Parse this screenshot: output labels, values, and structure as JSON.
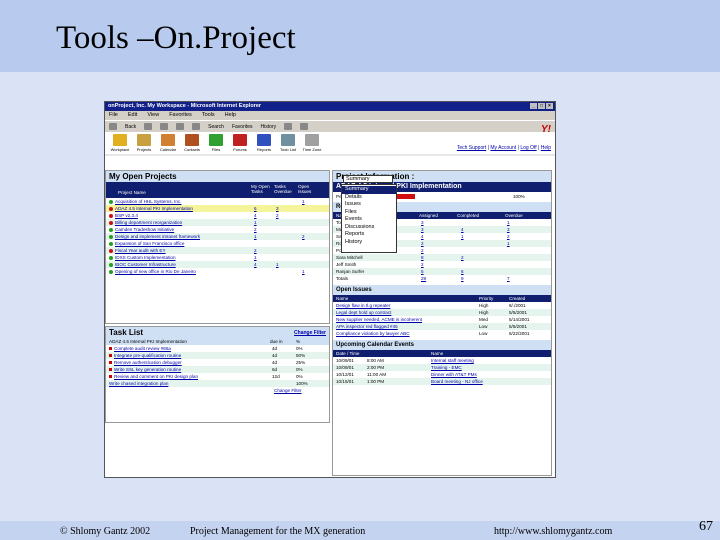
{
  "slide": {
    "title": "Tools –On.Project",
    "footer_left": "© Shlomy Gantz 2002",
    "footer_center": "Project Management for the MX generation",
    "footer_right": "http://www.shlomygantz.com",
    "page_number": "67"
  },
  "browser": {
    "window_title": "onProject, Inc. My Workspace - Microsoft Internet Explorer",
    "menu": [
      "File",
      "Edit",
      "View",
      "Favorites",
      "Tools",
      "Help"
    ],
    "nav": [
      "Back",
      "Search",
      "Favorites",
      "History"
    ],
    "tools": [
      "Workplace",
      "Projects",
      "Calendar",
      "Contacts",
      "Files",
      "Forums",
      "Reports",
      "Todo List",
      "Time Zone"
    ],
    "top_links": [
      "Tech Support",
      "My Account",
      "Log Off",
      "Help"
    ]
  },
  "open_projects": {
    "title": "My Open Projects",
    "headers": [
      "Project Name",
      "My Open Tasks",
      "Tasks Overdue",
      "Open Issues"
    ],
    "rows": [
      {
        "name": "Acquisition of HHL Systems, Inc.",
        "tasks": "",
        "overdue": "",
        "issues": "1",
        "color": "#22a022"
      },
      {
        "name": "ADAZ 4.5 Internal PKI Implementation",
        "tasks": "6",
        "overdue": "3",
        "issues": "",
        "color": "#d01010"
      },
      {
        "name": "BSP v2.3.4",
        "tasks": "4",
        "overdue": "2",
        "issues": "",
        "color": "#d01010"
      },
      {
        "name": "Billing department reorganization",
        "tasks": "1",
        "overdue": "",
        "issues": "",
        "color": "#d01010"
      },
      {
        "name": "Camden Tradeshow Initiative",
        "tasks": "2",
        "overdue": "",
        "issues": "",
        "color": "#22a022"
      },
      {
        "name": "Design and implement intranet framework",
        "tasks": "1",
        "overdue": "",
        "issues": "2",
        "color": "#22a022"
      },
      {
        "name": "Expansion of San Francisco office",
        "tasks": "",
        "overdue": "",
        "issues": "",
        "color": "#22a022"
      },
      {
        "name": "Fiscal Year audit with EY",
        "tasks": "2",
        "overdue": "",
        "issues": "",
        "color": "#d01010"
      },
      {
        "name": "IDXS Custom Implementation",
        "tasks": "1",
        "overdue": "",
        "issues": "",
        "color": "#22a022"
      },
      {
        "name": "IBOC Customer Infrastructure",
        "tasks": "4",
        "overdue": "1",
        "issues": "",
        "color": "#22a022"
      },
      {
        "name": "Opening of new office in Rio De Janeiro",
        "tasks": "",
        "overdue": "",
        "issues": "1",
        "color": "#22a022"
      }
    ]
  },
  "task_list": {
    "title": "Task List",
    "change_filter": "Change Filter",
    "headers": [
      "ADAZ 4.5 Internal PKI Implementation",
      "due in",
      "%"
    ],
    "rows": [
      {
        "name": "Complete audit review #66a",
        "due": "4d",
        "pct": "0%"
      },
      {
        "name": "Integrate pre-qualification routine",
        "due": "4d",
        "pct": "50%"
      },
      {
        "name": "Remove authentication debugger",
        "due": "4d",
        "pct": "25%"
      },
      {
        "name": "Write SSL key generation routine",
        "due": "6d",
        "pct": "0%"
      },
      {
        "name": "Review and comment on PKI design plan",
        "due": "12d",
        "pct": "0%"
      },
      {
        "name": "Write chased integration plan",
        "due": "",
        "pct": "100%"
      }
    ]
  },
  "project_info": {
    "title": "Project Information :",
    "select_value": "Summary",
    "dropdown": [
      "Summary",
      "Details",
      "Issues",
      "Files",
      "Events",
      "Discussions",
      "Reports",
      "History"
    ],
    "banner": "ADAZ 4.5 Internal PKI Implementation",
    "percent_label": "Percent Complete",
    "percent_value": "100%",
    "resources_title": "Resources",
    "resources_headers": [
      "Name",
      "Assigned",
      "Completed",
      "Overdue"
    ],
    "resources": [
      {
        "name": "Tony Andrews",
        "a": "3",
        "c": "",
        "o": "1"
      },
      {
        "name": "Maria Brooks",
        "a": "3",
        "c": "4",
        "o": "3"
      },
      {
        "name": "Samantha Condor",
        "a": "4",
        "c": "1",
        "o": "2"
      },
      {
        "name": "Roy Boner",
        "a": "2",
        "c": "",
        "o": "1"
      },
      {
        "name": "Pol Jessop",
        "a": "2",
        "c": "",
        "o": ""
      },
      {
        "name": "Sara Mitchell",
        "a": "8",
        "c": "2",
        "o": ""
      },
      {
        "name": "Jeff Smith",
        "a": "2",
        "c": "",
        "o": ""
      },
      {
        "name": "Ranjan Surfer",
        "a": "5",
        "c": "6",
        "o": ""
      },
      {
        "name": "Totals",
        "a": "29",
        "c": "9",
        "o": "7"
      }
    ]
  },
  "open_issues": {
    "title": "Open Issues",
    "headers": [
      "Name",
      "Priority",
      "Created"
    ],
    "rows": [
      {
        "name": "Design flaw in tl.g repeater",
        "p": "High",
        "d": "6/./2001"
      },
      {
        "name": "Legal dept hold up contract",
        "p": "High",
        "d": "5/5/2001"
      },
      {
        "name": "New supplier needed, ACME is incoherent",
        "p": "Med",
        "d": "5/14/2001"
      },
      {
        "name": "APA inspector red flagged #45",
        "p": "Low",
        "d": "5/5/2001"
      },
      {
        "name": "Compliance violation by lawyer ABC",
        "p": "Low",
        "d": "6/22/2001"
      }
    ]
  },
  "calendar": {
    "title": "Upcoming Calendar Events",
    "headers": [
      "Date / Time",
      "Name"
    ],
    "rows": [
      {
        "date": "10/09/01",
        "time": "8:00 AM",
        "name": "Internal staff meeting"
      },
      {
        "date": "10/09/01",
        "time": "2:00 PM",
        "name": "Training - EMC"
      },
      {
        "date": "10/12/01",
        "time": "11:00 AM",
        "name": "Dinner with AT&T PMs"
      },
      {
        "date": "10/15/01",
        "time": "1:00 PM",
        "name": "Board meeting - NJ office"
      }
    ]
  }
}
